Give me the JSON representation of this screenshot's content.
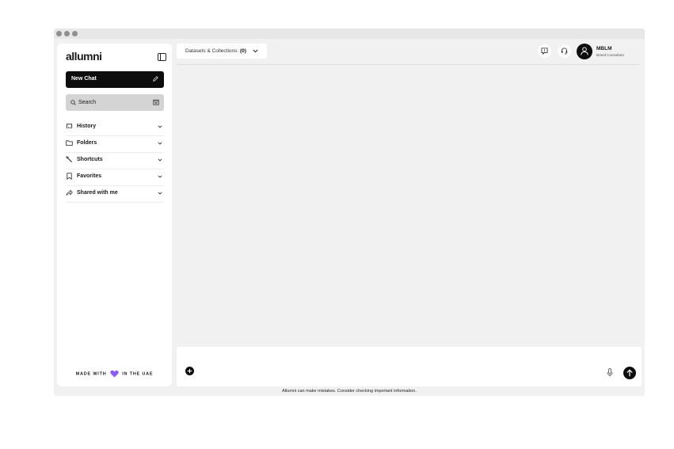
{
  "sidebar": {
    "logo": "allumni",
    "new_chat_label": "New Chat",
    "search_label": "Search",
    "items": [
      {
        "label": "History",
        "icon": "history-icon"
      },
      {
        "label": "Folders",
        "icon": "folder-icon"
      },
      {
        "label": "Shortcuts",
        "icon": "shortcut-icon"
      },
      {
        "label": "Favorites",
        "icon": "bookmark-icon"
      },
      {
        "label": "Shared with me",
        "icon": "share-icon"
      }
    ],
    "made_with_before": "MADE WITH",
    "made_with_after": "IN THE UAE"
  },
  "topbar": {
    "datasets_label": "Datasets & Collections:",
    "datasets_count": "(0)",
    "user_name": "MBLM",
    "user_role": "Brand Consultant"
  },
  "footer": {
    "disclaimer": "Allumni can make mistakes. Consider checking important information."
  },
  "colors": {
    "app_bg": "#f0f1f0",
    "primary": "#0d0d0d",
    "heart": "#8b5cf6"
  }
}
